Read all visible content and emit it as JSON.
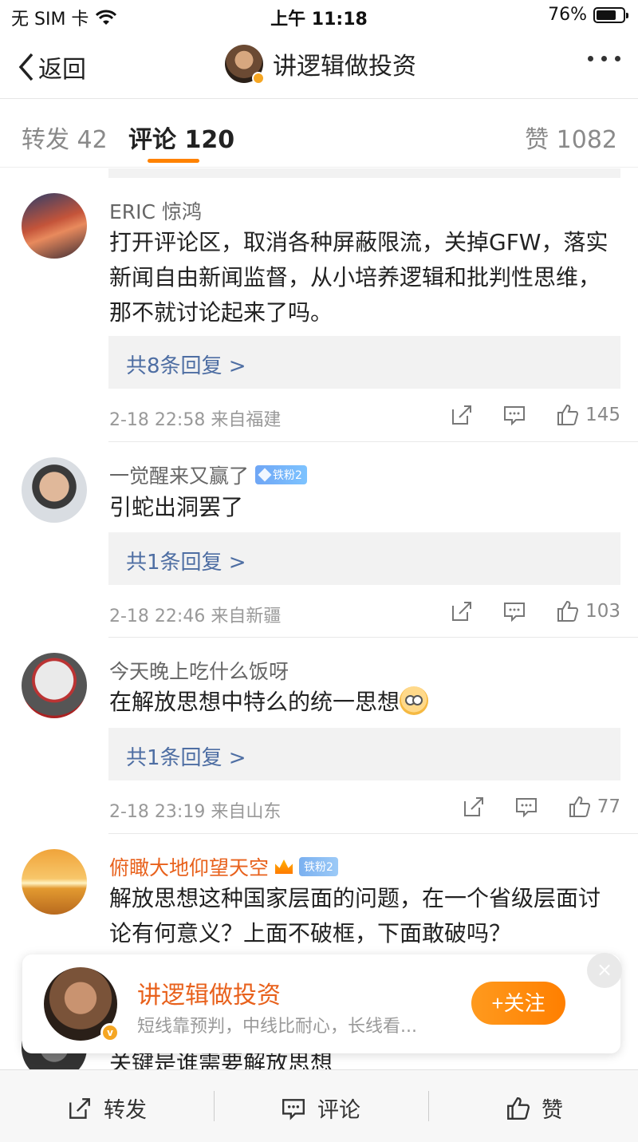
{
  "status": {
    "carrier": "无 SIM 卡",
    "time": "上午 11:18",
    "battery_pct": "76%",
    "battery_level": 0.76
  },
  "nav": {
    "back_label": "返回",
    "title": "讲逻辑做投资"
  },
  "tabs": [
    {
      "label": "转发 42"
    },
    {
      "label": "评论 120"
    },
    {
      "label": "赞 1082"
    }
  ],
  "comments": [
    {
      "name": "ERIC 惊鸿",
      "text": "打开评论区，取消各种屏蔽限流，关掉GFW，落实新闻自由新闻监督，从小培养逻辑和批判性思维，那不就讨论起来了吗。",
      "reply": "共8条回复 >",
      "meta": "2-18 22:58  来自福建",
      "likes": "145"
    },
    {
      "name": "一觉醒来又赢了",
      "badge": "铁粉2",
      "text": "引蛇出洞罢了",
      "reply": "共1条回复 >",
      "meta": "2-18 22:46  来自新疆",
      "likes": "103"
    },
    {
      "name": "今天晚上吃什么饭呀",
      "text": "在解放思想中特么的统一思想",
      "reply": "共1条回复 >",
      "meta": "2-18 23:19  来自山东",
      "likes": "77"
    },
    {
      "name": "俯瞰大地仰望天空",
      "badge": "铁粉2",
      "text": "解放思想这种国家层面的问题，在一个省级层面讨论有何意义？上面不破框，下面敢破吗？"
    }
  ],
  "peek_text": "关键是谁需要解放思想",
  "follow_card": {
    "name": "讲逻辑做投资",
    "desc": "短线靠预判，中线比耐心，长线看...",
    "follow_label": "+关注",
    "close": "×"
  },
  "bottom": {
    "repost": "转发",
    "comment": "评论",
    "like": "赞"
  }
}
